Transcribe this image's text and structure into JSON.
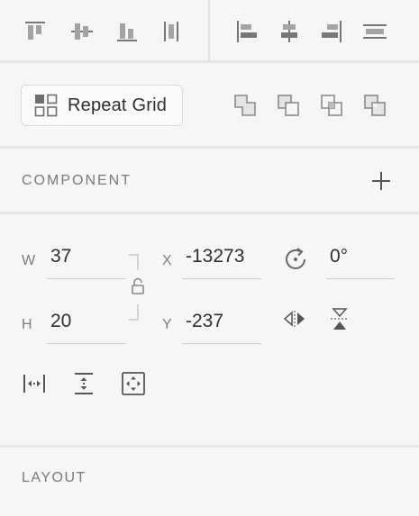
{
  "toolbar": {
    "align_vertical": [
      {
        "icon": "align-top-icon"
      },
      {
        "icon": "align-middle-icon"
      },
      {
        "icon": "align-bottom-icon"
      },
      {
        "icon": "distribute-vertical-icon"
      }
    ],
    "align_horizontal": [
      {
        "icon": "align-left-icon"
      },
      {
        "icon": "align-center-icon"
      },
      {
        "icon": "align-right-icon"
      },
      {
        "icon": "distribute-horizontal-icon"
      }
    ]
  },
  "repeat_grid": {
    "label": "Repeat Grid",
    "icon": "grid-icon"
  },
  "boolean_ops": [
    {
      "icon": "union-icon"
    },
    {
      "icon": "subtract-icon"
    },
    {
      "icon": "intersect-icon"
    },
    {
      "icon": "exclude-icon"
    }
  ],
  "component": {
    "title": "COMPONENT",
    "add_icon": "plus-icon"
  },
  "transform": {
    "w_label": "W",
    "w_value": "37",
    "h_label": "H",
    "h_value": "20",
    "x_label": "X",
    "x_value": "-13273",
    "y_label": "Y",
    "y_value": "-237",
    "rotation_value": "0°",
    "lock_icon": "unlock-icon",
    "rotate_icon": "rotate-icon",
    "flip_h_icon": "flip-horizontal-icon",
    "flip_v_icon": "flip-vertical-icon"
  },
  "responsive": [
    {
      "icon": "fixed-width-icon"
    },
    {
      "icon": "fixed-height-icon"
    },
    {
      "icon": "responsive-resize-icon"
    }
  ],
  "layout": {
    "title": "LAYOUT"
  },
  "colors": {
    "panel_bg": "#f6f6f6",
    "icon": "#6e6e6e",
    "separator": "#e6e6e6"
  }
}
